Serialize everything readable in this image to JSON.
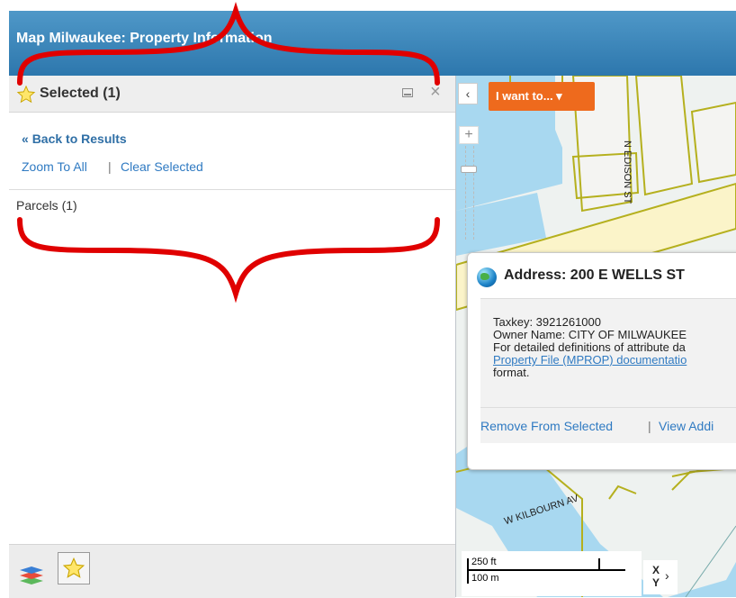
{
  "header": {
    "title": "Map Milwaukee: Property Information"
  },
  "panel": {
    "title": "Selected (1)",
    "back_label": "Back to Results",
    "zoom_all_label": "Zoom To All",
    "separator": "|",
    "clear_label": "Clear Selected",
    "group_label": "Parcels (1)"
  },
  "map": {
    "collapse_label": "‹",
    "iwant_label": "I want to... ▾",
    "zoom_in_label": "+",
    "street_edison": "N EDISON ST",
    "street_kilbourn": "W KILBOURN AV",
    "popup": {
      "title": "Address: 200 E WELLS ST",
      "taxkey": "Taxkey: 3921261000",
      "owner": "Owner Name: CITY OF MILWAUKEE",
      "definitions": "For detailed definitions of attribute da",
      "doc_link": "Property File (MPROP) documentatio",
      "format": "format.",
      "remove_label": "Remove From Selected",
      "action_sep": "|",
      "view_label": "View Addi"
    },
    "scale": {
      "feet": "250 ft",
      "meters": "100 m"
    },
    "xy": {
      "x": "X",
      "y": "Y",
      "chevron": "›"
    }
  },
  "colors": {
    "header": "#2d77ad",
    "accent_orange": "#ee6a1d",
    "link": "#2f7ac2",
    "water": "#a8d8f0",
    "parcel_outline": "#b5b01e",
    "annotation_red": "#e00000"
  }
}
